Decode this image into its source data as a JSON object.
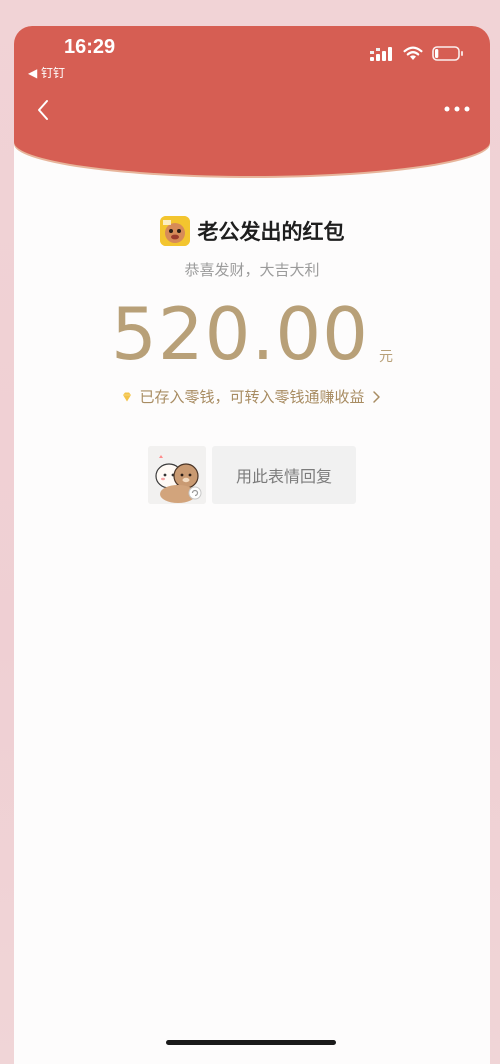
{
  "status_bar": {
    "time": "16:29",
    "back_app": "◀ 钉钉",
    "signal_icon": "signal-icon",
    "wifi_icon": "wifi-icon",
    "battery_icon": "battery-icon",
    "battery_level": 0.15
  },
  "nav": {
    "back_icon": "chevron-left-icon",
    "more_icon": "more-icon"
  },
  "red_packet": {
    "sender": "老公发出的红包",
    "greeting": "恭喜发财，大吉大利",
    "amount": "520.00",
    "currency": "元",
    "wallet_note": "已存入零钱，可转入零钱通赚收益",
    "wallet_icon": "diamond-icon",
    "wallet_arrow_icon": "chevron-right-icon"
  },
  "reply": {
    "sticker_icon": "bear-sticker-icon",
    "button_label": "用此表情回复"
  },
  "colors": {
    "header_red": "#d65e53",
    "amount_gold": "#b8a078",
    "background_pink": "#f1d3d6"
  }
}
